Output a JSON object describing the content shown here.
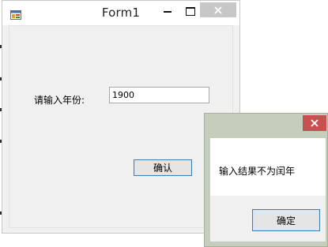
{
  "main_window": {
    "title": "Form1",
    "form": {
      "year_label": "请输入年份:",
      "year_value": "1900",
      "confirm_label": "确认"
    }
  },
  "dialog": {
    "message": "输入结果不为闰年",
    "ok_label": "确定"
  },
  "colors": {
    "dialog_close": "#c75050",
    "main_close": "#c7c7c7",
    "button_border": "#3c7fb1",
    "dialog_frame": "#c5cdbd"
  },
  "icons": {
    "app": "app-icon",
    "minimize": "minimize-icon",
    "maximize": "maximize-icon",
    "close": "close-icon"
  }
}
